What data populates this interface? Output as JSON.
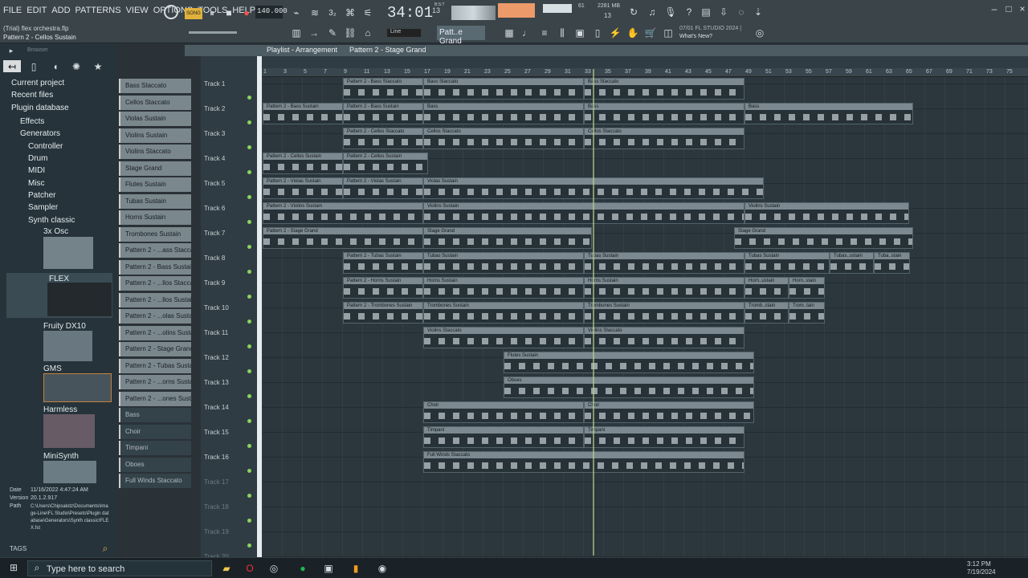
{
  "menu": [
    "FILE",
    "EDIT",
    "ADD",
    "PATTERNS",
    "VIEW",
    "OPTIONS",
    "TOOLS",
    "HELP"
  ],
  "project": {
    "file": "(Trial) flex orchestra.flp",
    "pattern": "Pattern 2 - Cellos Sustain"
  },
  "transport": {
    "mode": "SONG",
    "tempo": "140.000",
    "time": "34:01",
    "time_ticks": "13",
    "beat_label": "B:S:T",
    "cpu": "61",
    "mem": "2281 MB",
    "voices": "13"
  },
  "toolbar": {
    "line": "Line",
    "pattern": "Patt..e Grand",
    "news": "07/01 FL STUDIO 2024 |",
    "whats_new": "What's New?"
  },
  "browser": {
    "title": "Browser",
    "items": [
      "Current project",
      "Recent files",
      "Plugin database",
      "Effects",
      "Generators",
      "Controller",
      "Drum",
      "MIDI",
      "Misc",
      "Patcher",
      "Sampler",
      "Synth classic",
      "3x Osc",
      "FLEX",
      "Fruity DX10",
      "GMS",
      "Harmless",
      "MiniSynth"
    ],
    "date_label": "Date",
    "date": "11/16/2022 4:47:24 AM",
    "version_label": "Version",
    "version": "20.1.2.917",
    "path_label": "Path",
    "path": "C:\\Users\\Chipsalotz\\Documents\\Image-Line\\FL Studio\\Presets\\Plugin database\\Generators\\Synth classic\\FLEX.fst",
    "tags": "TAGS"
  },
  "channels": [
    "Bass Staccato",
    "Cellos Staccato",
    "Violas Sustain",
    "Violins Sustain",
    "Violins Staccato",
    "Stage Grand",
    "Flutes Sustain",
    "Tubas Sustain",
    "Horns Sustain",
    "Trombones Sustain",
    "Pattern 2 - ...ass Staccato",
    "Pattern 2 - Bass Sustain",
    "Pattern 2 - ...llos Staccato",
    "Pattern 2 - ...llos Sustain",
    "Pattern 2 - ...olas Sustain",
    "Pattern 2 - ...olins Sustain",
    "Pattern 2 - Stage Grand",
    "Pattern 2 - Tubas Sustain",
    "Pattern 2 - ...orns Sustain",
    "Pattern 2 - ...ones Sustain",
    "Bass",
    "Choir",
    "Timpani",
    "Oboes",
    "Full Winds Staccato"
  ],
  "playlist": {
    "title": "Playlist - Arrangement",
    "pattern": "Pattern 2 - Stage Grand",
    "ruler": [
      "1",
      "3",
      "5",
      "7",
      "9",
      "11",
      "13",
      "15",
      "17",
      "19",
      "21",
      "23",
      "25",
      "27",
      "29",
      "31",
      "33",
      "35",
      "37",
      "39",
      "41",
      "43",
      "45",
      "47",
      "49",
      "51",
      "53",
      "55",
      "57",
      "59",
      "61",
      "63",
      "65",
      "67",
      "69",
      "71",
      "73",
      "75"
    ],
    "tracks": [
      "Track 1",
      "Track 2",
      "Track 3",
      "Track 4",
      "Track 5",
      "Track 6",
      "Track 7",
      "Track 8",
      "Track 9",
      "Track 10",
      "Track 11",
      "Track 12",
      "Track 13",
      "Track 14",
      "Track 15",
      "Track 16",
      "Track 17",
      "Track 18",
      "Track 19",
      "Track 20"
    ]
  },
  "clips": [
    [
      "Pattern 2 - Bass Staccato",
      0,
      177,
      100
    ],
    [
      "Bass Staccato",
      0,
      277,
      200
    ],
    [
      "Bass Staccato",
      0,
      477,
      200
    ],
    [
      "Pattern 2 - Bass Sustain",
      1,
      77,
      100
    ],
    [
      "Pattern 2 - Bass Sustain",
      1,
      177,
      100
    ],
    [
      "Bass",
      1,
      277,
      200
    ],
    [
      "Bass",
      1,
      477,
      200
    ],
    [
      "Bass",
      1,
      677,
      210
    ],
    [
      "Pattern 2 - Cellos Staccato",
      2,
      177,
      100
    ],
    [
      "Cellos Staccato",
      2,
      277,
      200
    ],
    [
      "Cellos Staccato",
      2,
      477,
      200
    ],
    [
      "Pattern 2 - Cellos Sustain",
      3,
      77,
      100
    ],
    [
      "Pattern 2 - Cellos Sustain",
      3,
      177,
      106
    ],
    [
      "Pattern 2 - Violas Sustain",
      4,
      77,
      100
    ],
    [
      "Pattern 2 - Violas Sustain",
      4,
      177,
      100
    ],
    [
      "Violas Sustain",
      4,
      277,
      424
    ],
    [
      "Pattern 2 - Violins Sustain",
      5,
      77,
      200
    ],
    [
      "Violins Sustain",
      5,
      277,
      400
    ],
    [
      "Violins Sustain",
      5,
      677,
      205
    ],
    [
      "Pattern 2 - Stage Grand",
      6,
      77,
      200
    ],
    [
      "Stage Grand",
      6,
      277,
      210
    ],
    [
      "Stage Grand",
      6,
      664,
      223
    ],
    [
      "Pattern 2 - Tubas Sustain",
      7,
      177,
      100
    ],
    [
      "Tubas Sustain",
      7,
      277,
      200
    ],
    [
      "Tubas Sustain",
      7,
      477,
      200
    ],
    [
      "Tubas Sustain",
      7,
      677,
      106
    ],
    [
      "Tubas..ustain",
      7,
      783,
      55
    ],
    [
      "Tuba..stain",
      7,
      838,
      45
    ],
    [
      "Pattern 2 - Horns Sustain",
      8,
      177,
      100
    ],
    [
      "Horns Sustain",
      8,
      277,
      200
    ],
    [
      "Horns Sustain",
      8,
      477,
      200
    ],
    [
      "Horn..ustain",
      8,
      677,
      55
    ],
    [
      "Horn..stain",
      8,
      732,
      45
    ],
    [
      "Pattern 2 - Trombones Sustain",
      9,
      177,
      100
    ],
    [
      "Trombones Sustain",
      9,
      277,
      200
    ],
    [
      "Trombones Sustain",
      9,
      477,
      200
    ],
    [
      "Tromb..stain",
      9,
      677,
      55
    ],
    [
      "Trom..tain",
      9,
      732,
      45
    ],
    [
      "Violins Staccato",
      10,
      277,
      200
    ],
    [
      "Violins Staccato",
      10,
      477,
      200
    ],
    [
      "Flutes Sustain",
      11,
      377,
      312
    ],
    [
      "Oboes",
      12,
      377,
      312
    ],
    [
      "Choir",
      13,
      277,
      200
    ],
    [
      "Choir",
      13,
      477,
      212
    ],
    [
      "Timpani",
      14,
      277,
      200
    ],
    [
      "Timpani",
      14,
      477,
      200
    ],
    [
      "Full Winds Staccato",
      15,
      277,
      400
    ]
  ]
}
